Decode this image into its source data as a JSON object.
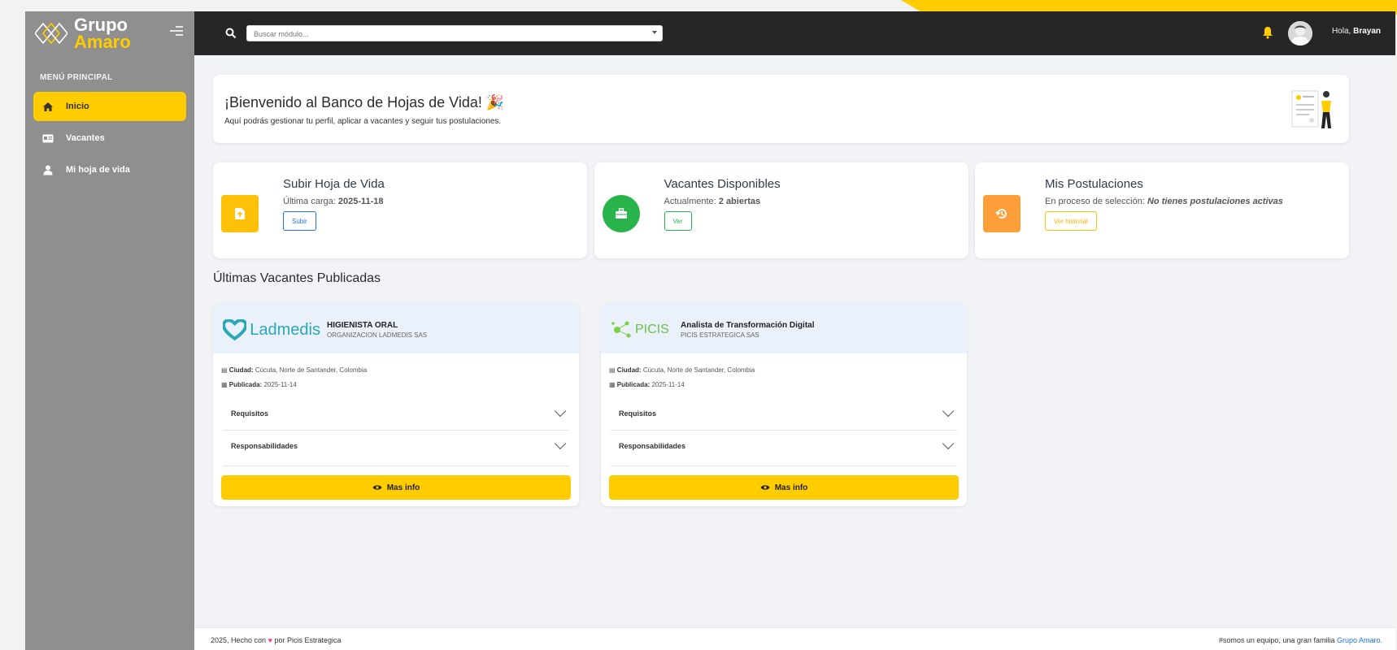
{
  "sidebar": {
    "brand_line1": "Grupo",
    "brand_line2": "Amaro",
    "menu_title": "MENÚ PRINCIPAL",
    "items": [
      {
        "label": "Inicio",
        "icon": "home-icon",
        "active": true
      },
      {
        "label": "Vacantes",
        "icon": "id-card-icon",
        "active": false
      },
      {
        "label": "Mi hoja de vida",
        "icon": "user-icon",
        "active": false
      }
    ]
  },
  "topbar": {
    "search_placeholder": "Buscar módulo...",
    "greeting": "Hola,",
    "user_name": "Brayan"
  },
  "welcome": {
    "title": "¡Bienvenido al Banco de Hojas de Vida! 🎉",
    "subtitle": "Aquí podrás gestionar tu perfil, aplicar a vacantes y seguir tus postulaciones."
  },
  "cards": [
    {
      "title": "Subir Hoja de Vida",
      "sub_label": "Última carga:",
      "sub_value": "2025-11-18",
      "button": "Subir",
      "color": "#ffc107"
    },
    {
      "title": "Vacantes Disponibles",
      "sub_label": "Actualmente:",
      "sub_value": "2 abiertas",
      "button": "Ver",
      "color": "#28b34b"
    },
    {
      "title": "Mis Postulaciones",
      "sub_label": "En proceso de selección:",
      "sub_value": "No tienes postulaciones activas",
      "button": "Ver historial",
      "color": "#ff9f3b"
    }
  ],
  "section_title": "Últimas Vacantes Publicadas",
  "vacancies": [
    {
      "logo_text": "Ladmedis",
      "title": "HIGIENISTA ORAL",
      "company": "ORGANIZACION LADMEDIS SAS",
      "city_label": "Ciudad:",
      "city": "Cúcuta, Norte de Santander, Colombia",
      "published_label": "Publicada:",
      "published": "2025-11-14",
      "req": "Requisitos",
      "resp": "Responsabilidades",
      "button": "Mas info"
    },
    {
      "logo_text": "PICIS",
      "title": "Analista de Transformación Digital",
      "company": "PICIS ESTRATEGICA SAS",
      "city_label": "Ciudad:",
      "city": "Cúcuta, Norte de Santander, Colombia",
      "published_label": "Publicada:",
      "published": "2025-11-14",
      "req": "Requisitos",
      "resp": "Responsabilidades",
      "button": "Mas info"
    }
  ],
  "footer": {
    "left_prefix": "2025, Hecho con",
    "left_suffix": "por Picis Estrategica",
    "right_text": "#somos un equipo, una gran familia",
    "right_link": "Grupo Amaro."
  },
  "colors": {
    "accent": "#ffcc00",
    "topbar": "#262626",
    "sidebar": "#8f8f8f"
  }
}
